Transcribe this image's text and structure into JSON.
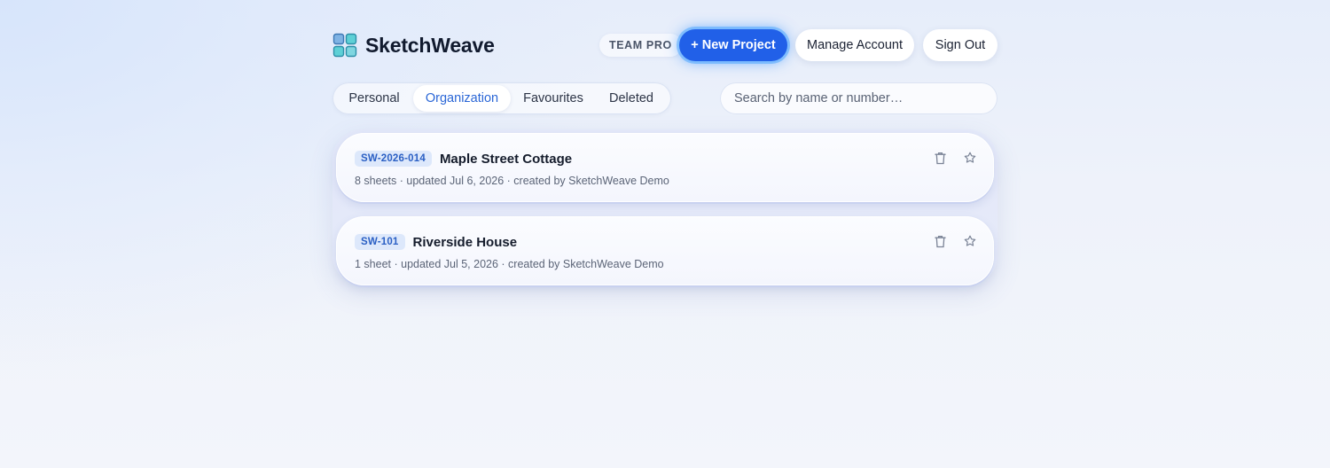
{
  "app": {
    "brand_name": "SketchWeave",
    "plan_badge": "TEAM PRO"
  },
  "header": {
    "new_project_label": "+ New Project",
    "manage_account_label": "Manage Account",
    "sign_out_label": "Sign Out"
  },
  "tabs": [
    {
      "label": "Personal",
      "active": false
    },
    {
      "label": "Organization",
      "active": true
    },
    {
      "label": "Favourites",
      "active": false
    },
    {
      "label": "Deleted",
      "active": false
    }
  ],
  "search": {
    "placeholder": "Search by name or number…",
    "value": ""
  },
  "projects": [
    {
      "code": "SW-2026-014",
      "title": "Maple Street Cottage",
      "meta": "8 sheets · updated Jul 6, 2026 · created by SketchWeave Demo"
    },
    {
      "code": "SW-101",
      "title": "Riverside House",
      "meta": "1 sheet · updated Jul 5, 2026 · created by SketchWeave Demo"
    }
  ],
  "icons": {
    "logo": "grid-logo-icon",
    "delete": "trash-icon",
    "favourite": "star-icon"
  },
  "colors": {
    "accent": "#2160e8",
    "accent_glow": "#52aaff",
    "active_tab_text": "#2a66d6",
    "code_badge_bg": "#dde8fb",
    "code_badge_text": "#2a5fc4"
  }
}
